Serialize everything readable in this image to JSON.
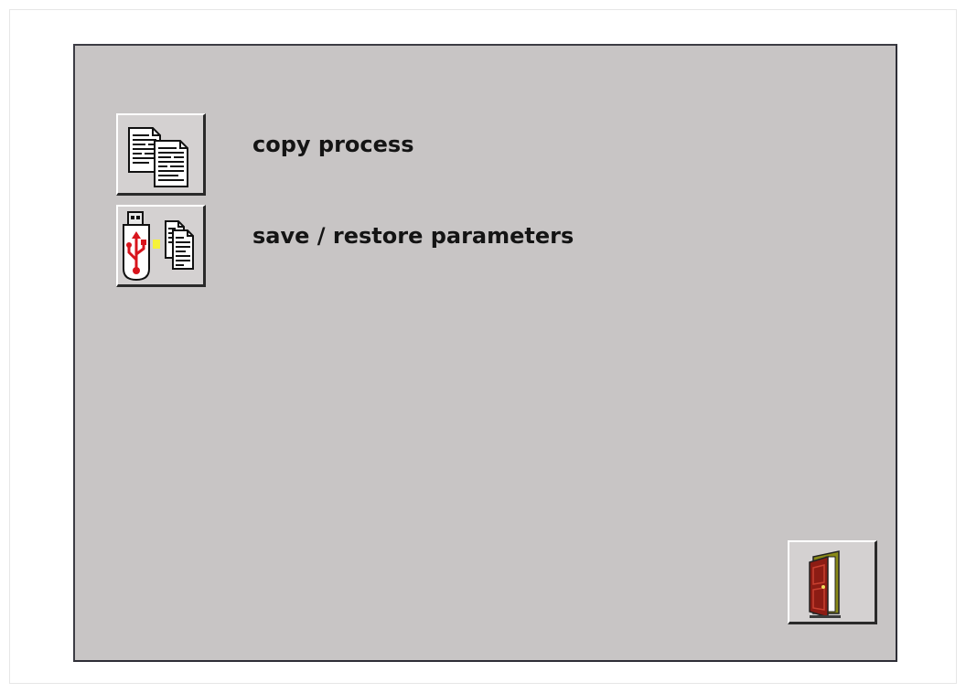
{
  "menu": {
    "items": [
      {
        "label": "copy process",
        "icon": "copy-documents-icon"
      },
      {
        "label": "save / restore parameters",
        "icon": "usb-save-restore-icon"
      }
    ]
  },
  "footer": {
    "exit_icon": "exit-door-icon"
  },
  "colors": {
    "panel_background": "#c8c5c5",
    "button_face": "#d4d1d1",
    "usb_red": "#d8141c",
    "led_yellow": "#f6f23a",
    "door_red": "#8c1c14",
    "door_frame": "#8a8a18"
  }
}
